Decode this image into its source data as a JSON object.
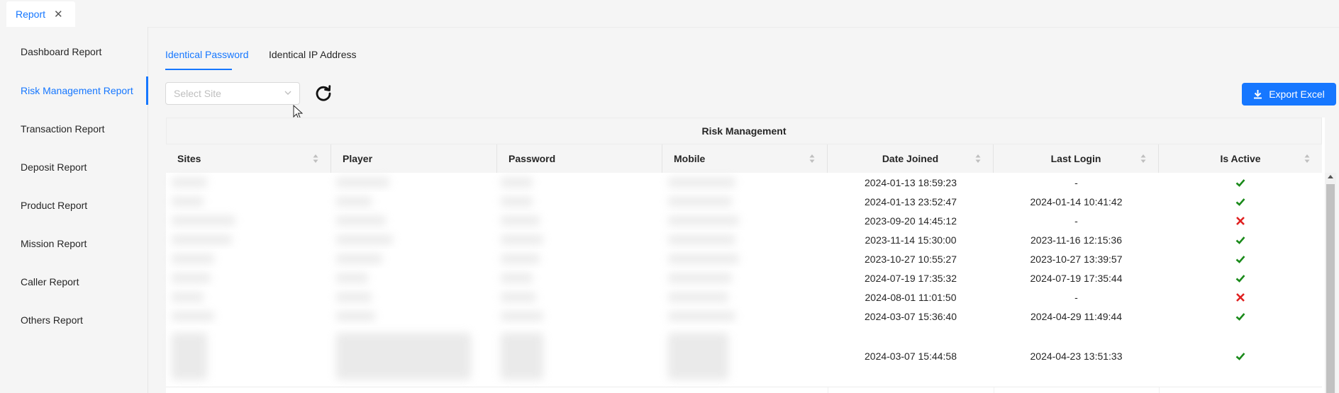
{
  "top_tab": {
    "label": "Report",
    "close_icon": "✕"
  },
  "sidebar": {
    "items": [
      {
        "label": "Dashboard Report"
      },
      {
        "label": "Risk Management Report",
        "active": true
      },
      {
        "label": "Transaction Report"
      },
      {
        "label": "Deposit Report"
      },
      {
        "label": "Product Report"
      },
      {
        "label": "Mission Report"
      },
      {
        "label": "Caller Report"
      },
      {
        "label": "Others Report"
      }
    ]
  },
  "tabs": [
    {
      "label": "Identical Password",
      "active": true
    },
    {
      "label": "Identical IP Address"
    }
  ],
  "filters": {
    "site_select_placeholder": "Select Site",
    "refresh_icon": "refresh-icon"
  },
  "toolbar": {
    "export_label": "Export Excel",
    "export_icon": "download-icon"
  },
  "colors": {
    "accent": "#1677ff",
    "active_check": "#1a8a1a",
    "inactive_cross": "#e02020"
  },
  "table": {
    "title": "Risk Management",
    "columns": [
      "Sites",
      "Player",
      "Password",
      "Mobile",
      "Date Joined",
      "Last Login",
      "Is Active"
    ],
    "rows": [
      {
        "date_joined": "2024-01-13 18:59:23",
        "last_login": "-",
        "is_active": true
      },
      {
        "date_joined": "2024-01-13 23:52:47",
        "last_login": "2024-01-14 10:41:42",
        "is_active": true
      },
      {
        "date_joined": "2023-09-20 14:45:12",
        "last_login": "-",
        "is_active": false
      },
      {
        "date_joined": "2023-11-14 15:30:00",
        "last_login": "2023-11-16 12:15:36",
        "is_active": true
      },
      {
        "date_joined": "2023-10-27 10:55:27",
        "last_login": "2023-10-27 13:39:57",
        "is_active": true
      },
      {
        "date_joined": "2024-07-19 17:35:32",
        "last_login": "2024-07-19 17:35:44",
        "is_active": true
      },
      {
        "date_joined": "2024-08-01 11:01:50",
        "last_login": "-",
        "is_active": false
      },
      {
        "date_joined": "2024-03-07 15:36:40",
        "last_login": "2024-04-29 11:49:44",
        "is_active": true
      },
      {
        "date_joined": "2024-03-07 15:44:58",
        "last_login": "2024-04-23 13:51:33",
        "is_active": true
      }
    ]
  }
}
